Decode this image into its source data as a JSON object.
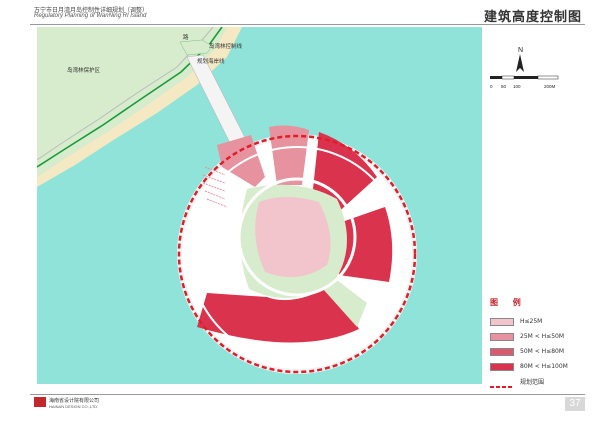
{
  "header": {
    "title_cn": "万宁市日月湾月岛控制性详细规划（调整）",
    "title_en": "Regulatory Planning of WanNing RI Island",
    "sheet_title": "建筑高度控制图"
  },
  "map": {
    "labels": {
      "forest_reserve": "岛湾林保护区",
      "forest_line": "岛湾林控制线",
      "shore_line": "规划海岸线",
      "coast_road": "路"
    },
    "colors": {
      "sea": "#8fe3d8",
      "land": "#d7eccc",
      "beach": "#f5e9c4",
      "h25": "#f2c4cc",
      "h50": "#e6939f",
      "h80": "#dc5a70",
      "h100": "#d9334d",
      "boundary": "#e01e2a"
    }
  },
  "scale_bar": {
    "north": "N",
    "ticks": [
      "0",
      "50",
      "100",
      "200M"
    ]
  },
  "legend": {
    "title": "图 例",
    "items": [
      {
        "label": "H≤25M",
        "color": "#f2c4cc"
      },
      {
        "label": "25M < H≤50M",
        "color": "#e6939f"
      },
      {
        "label": "50M < H≤80M",
        "color": "#dc5a70"
      },
      {
        "label": "80M < H≤100M",
        "color": "#d9334d"
      },
      {
        "label": "规划范围",
        "color": "#e01e2a"
      }
    ]
  },
  "footer": {
    "company_cn": "海南省设计院有限公司",
    "company_en": "HAINAN DESIGN CO.,LTD",
    "page": "37"
  }
}
